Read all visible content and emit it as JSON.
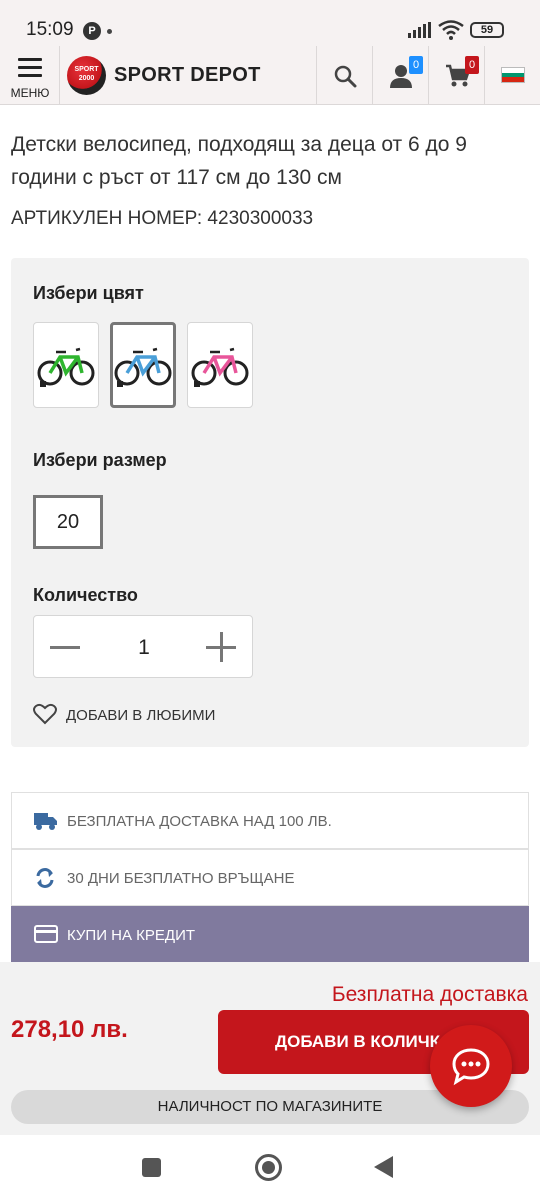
{
  "status_bar": {
    "time": "15:09",
    "notification_icon": "P",
    "battery": "59"
  },
  "header": {
    "menu_label": "МЕНЮ",
    "logo_badge_line1": "SPORT",
    "logo_badge_line2": "2000",
    "logo_text": "SPORT DEPOT",
    "account_count": "0",
    "cart_count": "0",
    "language_flag": "bulgaria-flag",
    "flag_colors": [
      "#ffffff",
      "#00966e",
      "#d62612"
    ]
  },
  "product": {
    "description": "Детски велосипед, подходящ за деца от 6 до 9 години с ръст от 117 см до 130 см",
    "article_number": "АРТИКУЛЕН НОМЕР: 4230300033"
  },
  "options": {
    "color_title": "Избери цвят",
    "colors": [
      {
        "name": "green",
        "hex": "#2fb52f",
        "selected": false
      },
      {
        "name": "blue",
        "hex": "#4a9fd8",
        "selected": true
      },
      {
        "name": "pink",
        "hex": "#e8559a",
        "selected": false
      }
    ],
    "size_title": "Избери размер",
    "size_value": "20",
    "quantity_title": "Количество",
    "quantity_value": "1",
    "favorites_label": "ДОБАВИ В ЛЮБИМИ"
  },
  "benefits": [
    {
      "icon": "truck-icon",
      "label": "БЕЗПЛАТНА ДОСТАВКА НАД 100 ЛВ."
    },
    {
      "icon": "refresh-icon",
      "label": "30 ДНИ БЕЗПЛАТНО ВРЪЩАНЕ"
    },
    {
      "icon": "credit-card-icon",
      "label": "КУПИ НА КРЕДИТ"
    }
  ],
  "bottom": {
    "free_delivery": "Безплатна доставка",
    "price": "278,10 лв.",
    "add_to_cart": "ДОБАВИ В КОЛИЧКАТА",
    "store_availability": "НАЛИЧНОСТ ПО МАГАЗИНИТЕ"
  },
  "colors": {
    "brand_red": "#c4161c",
    "credit_purple": "#807a9e",
    "badge_blue": "#1e90ff"
  }
}
